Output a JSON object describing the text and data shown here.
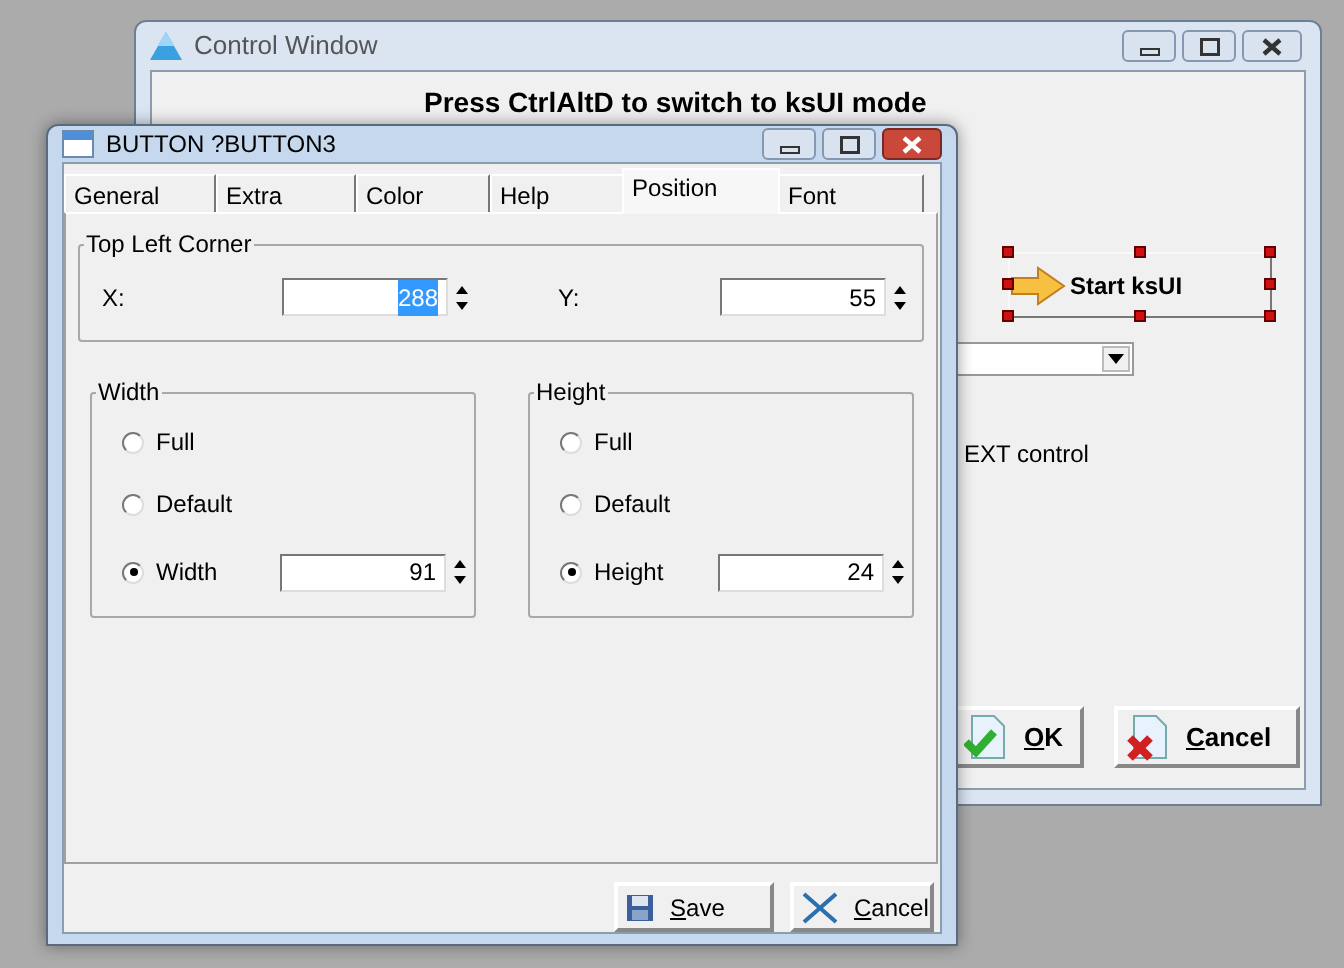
{
  "background_window": {
    "title": "Control Window",
    "heading": "Press CtrlAltD to switch to ksUI mode",
    "start_button": {
      "label": "Start ksUI",
      "selected": true
    },
    "text_fragment": "EXT control",
    "buttons": [
      {
        "label": "OK",
        "kind": "ok"
      },
      {
        "label": "Cancel",
        "kind": "cancel"
      }
    ]
  },
  "dialog": {
    "title": "BUTTON ?BUTTON3",
    "tabs": [
      {
        "label": "General",
        "selected": false
      },
      {
        "label": "Extra",
        "selected": false
      },
      {
        "label": "Color",
        "selected": false
      },
      {
        "label": "Help",
        "selected": false
      },
      {
        "label": "Position",
        "selected": true
      },
      {
        "label": "Font",
        "selected": false
      }
    ],
    "top_left_corner": {
      "title": "Top Left Corner",
      "fields": [
        {
          "label": "X:",
          "value": "288",
          "highlighted": true
        },
        {
          "label": "Y:",
          "value": "55",
          "highlighted": false
        }
      ]
    },
    "size_groups": [
      {
        "title": "Width",
        "options": [
          {
            "label": "Full",
            "selected": false
          },
          {
            "label": "Default",
            "selected": false
          },
          {
            "label": "Width",
            "selected": true
          }
        ],
        "value": "91"
      },
      {
        "title": "Height",
        "options": [
          {
            "label": "Full",
            "selected": false
          },
          {
            "label": "Default",
            "selected": false
          },
          {
            "label": "Height",
            "selected": true
          }
        ],
        "value": "24"
      }
    ],
    "buttons": [
      {
        "label": "Save",
        "kind": "save"
      },
      {
        "label": "Cancel",
        "kind": "cancel"
      }
    ]
  }
}
